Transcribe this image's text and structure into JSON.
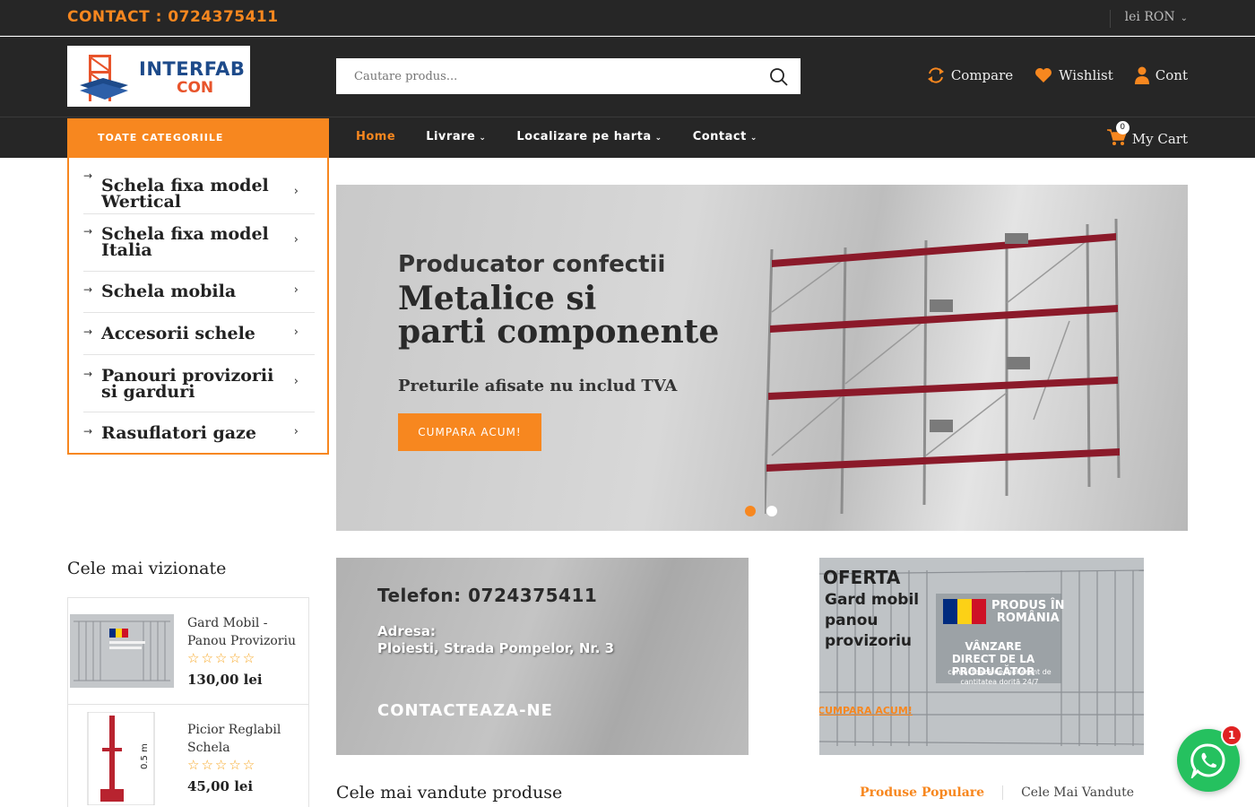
{
  "topbar": {
    "contact": "CONTACT : 0724375411",
    "currency": "lei RON"
  },
  "header": {
    "logo_line1": "INTERFAB",
    "logo_line2": "CON",
    "search_placeholder": "Cautare produs...",
    "compare": "Compare",
    "wishlist": "Wishlist",
    "account": "Cont"
  },
  "nav": {
    "categories_label": "TOATE CATEGORIILE",
    "items": [
      {
        "label": "Home"
      },
      {
        "label": "Livrare"
      },
      {
        "label": "Localizare pe harta"
      },
      {
        "label": "Contact"
      }
    ],
    "cart_label": "My Cart",
    "cart_count": "0"
  },
  "categories": [
    {
      "label": "Schela fixa model Wertical"
    },
    {
      "label": "Schela fixa model Italia"
    },
    {
      "label": "Schela mobila"
    },
    {
      "label": "Accesorii schele"
    },
    {
      "label": "Panouri provizorii si garduri"
    },
    {
      "label": "Rasuflatori gaze"
    }
  ],
  "hero": {
    "subtitle": "Producator confectii",
    "title_line1": "Metalice si",
    "title_line2": "parti componente",
    "note": "Preturile afisate nu includ TVA",
    "button": "CUMPARA ACUM!",
    "slide_count": 2,
    "active_slide": 0
  },
  "most_viewed": {
    "title": "Cele mai vizionate",
    "products": [
      {
        "name": "Gard Mobil - Panou Provizoriu",
        "stars": "☆☆☆☆☆",
        "price": "130,00 lei"
      },
      {
        "name": "Picior Reglabil Schela",
        "stars": "☆☆☆☆☆",
        "price": "45,00 lei",
        "dimension": "0.5 m"
      }
    ]
  },
  "contact_banner": {
    "phone": "Telefon: 0724375411",
    "address_label": "Adresa:",
    "address": "Ploiesti, Strada Pompelor, Nr. 3",
    "cta": "CONTACTEAZA-NE"
  },
  "offer_banner": {
    "title": "OFERTA",
    "description": "Gard mobil panou provizoriu",
    "badge_line1": "PRODUS ÎN",
    "badge_line2": "ROMÂNIA",
    "badge_sub": "VÂNZARE DIRECT DE LA PRODUCĂTOR",
    "badge_small": "contactează-ne indiferent de cantitatea dorită 24/7",
    "cta": "CUMPARA ACUM!",
    "colors": {
      "blue": "#002b7f",
      "yellow": "#fcd116",
      "red": "#ce1126"
    }
  },
  "best_sellers": {
    "title": "Cele mai vandute produse",
    "tabs": [
      {
        "label": "Produse Populare"
      },
      {
        "label": "Cele Mai Vandute"
      }
    ]
  },
  "whatsapp": {
    "badge": "1"
  },
  "colors": {
    "accent": "#f7871f",
    "dark": "#262626"
  }
}
